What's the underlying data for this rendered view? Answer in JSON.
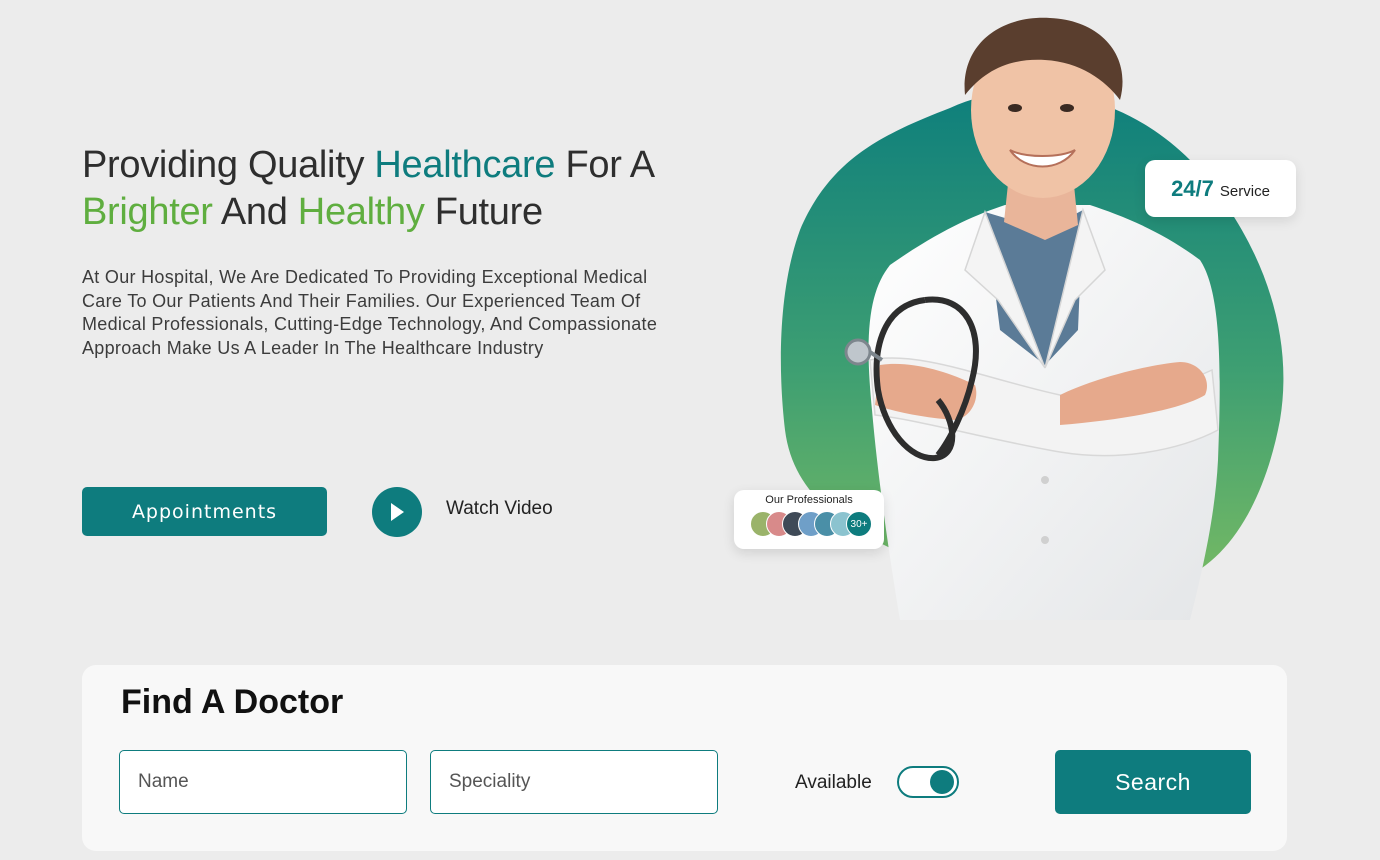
{
  "hero": {
    "title_part1": "Providing Quality ",
    "title_highlight1": "Healthcare",
    "title_part2": " For A ",
    "title_highlight2": "Brighter",
    "title_part3": " And ",
    "title_highlight3": "Healthy",
    "title_part4": " Future",
    "description": "At Our Hospital, We Are Dedicated To Providing Exceptional Medical Care To Our Patients And Their Families. Our Experienced Team Of Medical Professionals, Cutting-Edge Technology, And Compassionate Approach Make Us A Leader In The Healthcare Industry",
    "appointments_label": "Appointments",
    "watch_video_label": "Watch Video"
  },
  "badges": {
    "service_big": "24/7",
    "service_small": "Service",
    "professionals_title": "Our Professionals",
    "professionals_count": "30+"
  },
  "finder": {
    "title": "Find A Doctor",
    "name_placeholder": "Name",
    "speciality_placeholder": "Speciality",
    "available_label": "Available",
    "available_on": true,
    "search_label": "Search"
  },
  "colors": {
    "accent_teal": "#0e7c7e",
    "accent_green": "#5fae3f",
    "background": "#ececec"
  },
  "icons": {
    "play": "play-icon"
  }
}
